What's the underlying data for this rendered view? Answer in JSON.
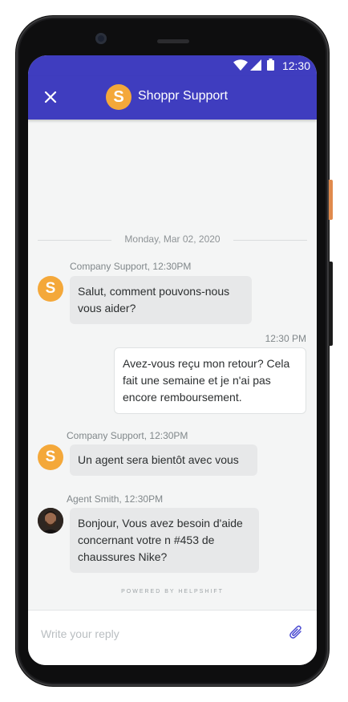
{
  "status_bar": {
    "time": "12:30"
  },
  "header": {
    "avatar_letter": "S",
    "title": "Shoppr Support"
  },
  "conversation": {
    "date": "Monday, Mar 02, 2020",
    "messages": [
      {
        "sender": "Company Support, 12:30PM",
        "avatar_letter": "S",
        "text": "Salut, comment pouvons-nous vous aider?"
      },
      {
        "time": "12:30 PM",
        "text": "Avez-vous reçu mon retour? Cela fait une semaine et je n'ai pas encore remboursement."
      },
      {
        "sender": "Company Support, 12:30PM",
        "avatar_letter": "S",
        "text": "Un agent sera bientôt avec vous"
      },
      {
        "sender": "Agent Smith, 12:30PM",
        "text": "Bonjour, Vous avez besoin d'aide concernant votre n #453 de chaussures Nike?"
      }
    ]
  },
  "powered_by": "POWERED BY HELPSHIFT",
  "reply": {
    "placeholder": "Write your reply"
  },
  "colors": {
    "brand": "#3f3dbf",
    "avatar": "#f4a83a",
    "background": "#f4f5f5",
    "attach": "#4a4ad1"
  }
}
